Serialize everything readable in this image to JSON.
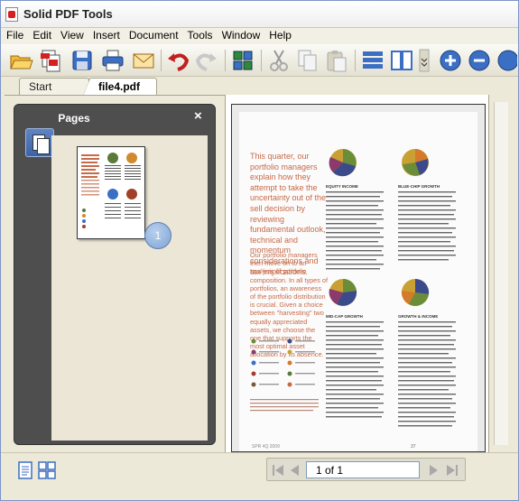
{
  "window": {
    "title": "Solid PDF Tools"
  },
  "menu": {
    "items": [
      "File",
      "Edit",
      "View",
      "Insert",
      "Document",
      "Tools",
      "Window",
      "Help"
    ]
  },
  "toolbar": {
    "buttons": [
      "open-icon",
      "new-pdf-icon",
      "save-icon",
      "print-icon",
      "email-icon",
      "undo-icon",
      "redo-icon",
      "scan-icon",
      "cut-icon",
      "copy-icon",
      "paste-icon",
      "single-page-icon",
      "two-page-icon",
      "zoom-in-icon",
      "zoom-out-icon"
    ]
  },
  "tabs": [
    {
      "label": "Start Page",
      "active": false
    },
    {
      "label": "file4.pdf",
      "active": true
    }
  ],
  "pages_panel": {
    "title": "Pages",
    "close": "×",
    "thumbnail_page": "1"
  },
  "document": {
    "intro": "This quarter, our portfolio managers explain how they attempt to take the uncertainty out of the sell decision by reviewing fundamental outlook, technical and momentum considerations and tax implications.",
    "intro2": "Our portfolio managers then move on to an analysis of portfolio composition. In all types of portfolios, an awareness of the portfolio distribution is crucial. Given a choice between \"harvesting\" two equally appreciated assets, we choose the one that supports the most optimal asset allocation by its absence.",
    "sections": [
      "EQUITY INCOME",
      "BLUE-CHIP GROWTH",
      "MID-CAP GROWTH",
      "GROWTH & INCOME"
    ],
    "footer_left": "SPR 4Q 2009",
    "footer_right": "37"
  },
  "nav": {
    "page_display": "1 of 1"
  },
  "colors": {
    "accent": "#3a6fc4",
    "panel": "#4e4e4e",
    "intro_text": "#c86a48"
  }
}
